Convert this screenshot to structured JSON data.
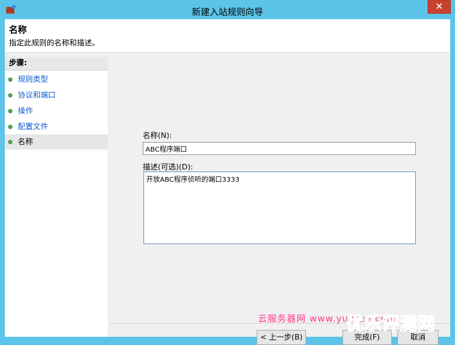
{
  "window": {
    "title": "新建入站规则向导",
    "close_symbol": "✕"
  },
  "header": {
    "title": "名称",
    "subtitle": "指定此规则的名称和描述。"
  },
  "sidebar": {
    "steps_label": "步骤:",
    "items": [
      {
        "label": "规则类型"
      },
      {
        "label": "协议和端口"
      },
      {
        "label": "操作"
      },
      {
        "label": "配置文件"
      },
      {
        "label": "名称"
      }
    ]
  },
  "form": {
    "name_label": "名称(N):",
    "name_value": "ABC程序端口",
    "desc_label": "描述(可选)(D):",
    "desc_value": "开放ABC程序侦听的端口3333"
  },
  "buttons": {
    "back": "< 上一步(B)",
    "finish": "完成(F)",
    "cancel": "取消"
  },
  "watermark": {
    "small": "云服务器网 www.yuntue.com",
    "big": "优乐评测网"
  },
  "colors": {
    "title_bar": "#5bc4e8",
    "close_button": "#c7432f",
    "step_link": "#0a5ad1",
    "step_dot": "#4caf50"
  }
}
